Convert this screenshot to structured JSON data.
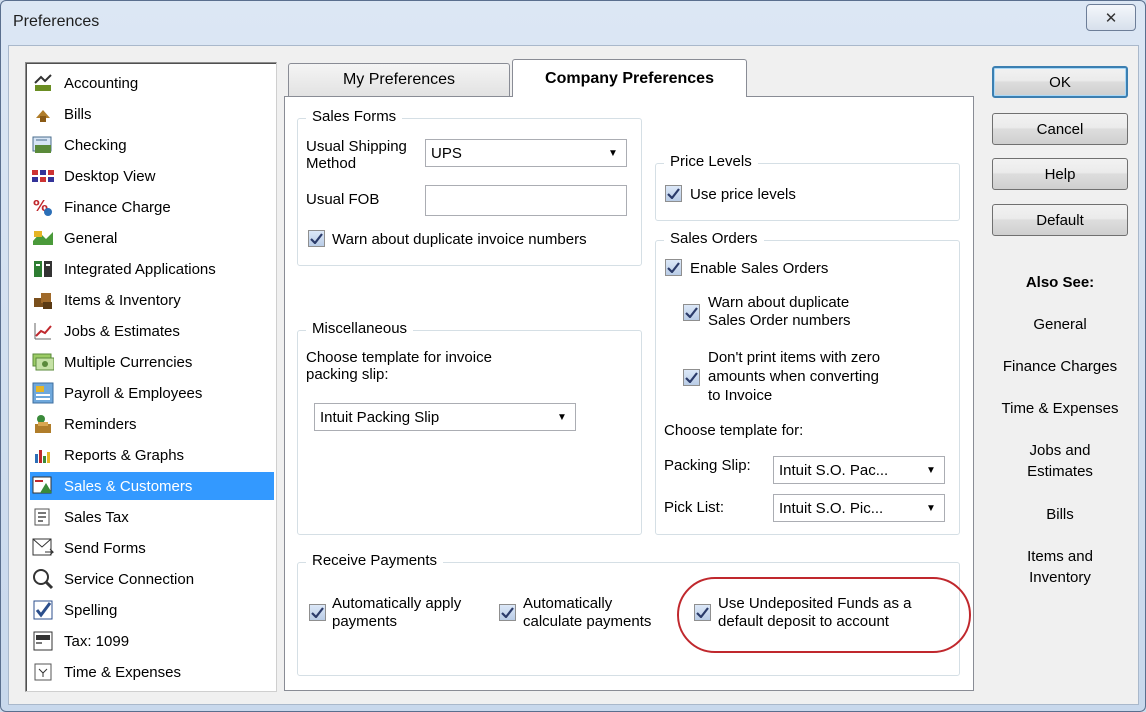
{
  "window": {
    "title": "Preferences",
    "close_glyph": "✕"
  },
  "sidebar": {
    "items": [
      {
        "label": "Accounting",
        "icon": "accounting-icon"
      },
      {
        "label": "Bills",
        "icon": "bills-icon"
      },
      {
        "label": "Checking",
        "icon": "checking-icon"
      },
      {
        "label": "Desktop View",
        "icon": "desktop-view-icon"
      },
      {
        "label": "Finance Charge",
        "icon": "finance-charge-icon"
      },
      {
        "label": "General",
        "icon": "general-icon"
      },
      {
        "label": "Integrated Applications",
        "icon": "integrated-applications-icon"
      },
      {
        "label": "Items & Inventory",
        "icon": "items-inventory-icon"
      },
      {
        "label": "Jobs & Estimates",
        "icon": "jobs-estimates-icon"
      },
      {
        "label": "Multiple Currencies",
        "icon": "multiple-currencies-icon"
      },
      {
        "label": "Payroll & Employees",
        "icon": "payroll-icon"
      },
      {
        "label": "Reminders",
        "icon": "reminders-icon"
      },
      {
        "label": "Reports & Graphs",
        "icon": "reports-graphs-icon"
      },
      {
        "label": "Sales & Customers",
        "icon": "sales-customers-icon",
        "selected": true
      },
      {
        "label": "Sales Tax",
        "icon": "sales-tax-icon"
      },
      {
        "label": "Send Forms",
        "icon": "send-forms-icon"
      },
      {
        "label": "Service Connection",
        "icon": "service-connection-icon"
      },
      {
        "label": "Spelling",
        "icon": "spelling-icon"
      },
      {
        "label": "Tax: 1099",
        "icon": "tax-1099-icon"
      },
      {
        "label": "Time & Expenses",
        "icon": "time-expenses-icon"
      }
    ]
  },
  "tabs": {
    "my": "My Preferences",
    "company": "Company Preferences"
  },
  "sales_forms": {
    "title": "Sales Forms",
    "shipping_label_1": "Usual Shipping",
    "shipping_label_2": "Method",
    "shipping_value": "UPS",
    "fob_label": "Usual FOB",
    "fob_value": "",
    "warn_dup_invoice": "Warn about duplicate invoice numbers",
    "warn_dup_invoice_checked": true
  },
  "misc": {
    "title": "Miscellaneous",
    "choose_label_1": "Choose template for invoice",
    "choose_label_2": "packing slip:",
    "template_value": "Intuit Packing Slip"
  },
  "price_levels": {
    "title": "Price Levels",
    "use_label": "Use price levels",
    "use_checked": true
  },
  "sales_orders": {
    "title": "Sales Orders",
    "enable_label": "Enable Sales Orders",
    "enable_checked": true,
    "warn_dup_1": "Warn about duplicate",
    "warn_dup_2": "Sales Order numbers",
    "warn_dup_checked": true,
    "dont_print_1": "Don't print items with zero",
    "dont_print_2": "amounts when converting",
    "dont_print_3": "to Invoice",
    "dont_print_checked": true,
    "choose_template": "Choose template for:",
    "packing_slip_label": "Packing Slip:",
    "packing_slip_value": "Intuit S.O. Pac...",
    "pick_list_label": "Pick List:",
    "pick_list_value": "Intuit S.O. Pic..."
  },
  "receive_payments": {
    "title": "Receive Payments",
    "auto_apply_1": "Automatically apply",
    "auto_apply_2": "payments",
    "auto_apply_checked": true,
    "auto_calc_1": "Automatically",
    "auto_calc_2": "calculate payments",
    "auto_calc_checked": true,
    "undeposited_1": "Use Undeposited Funds as a",
    "undeposited_2": "default deposit to account",
    "undeposited_checked": true
  },
  "buttons": {
    "ok": "OK",
    "cancel": "Cancel",
    "help": "Help",
    "default": "Default"
  },
  "also_see": {
    "title": "Also See:",
    "general": "General",
    "finance_charges": "Finance Charges",
    "time_expenses": "Time & Expenses",
    "jobs_1": "Jobs and",
    "jobs_2": "Estimates",
    "bills": "Bills",
    "items_1": "Items and",
    "items_2": "Inventory"
  },
  "colors": {
    "selection": "#3399ff",
    "highlight_oval": "#c0282d",
    "accent": "#3c7fb1"
  }
}
